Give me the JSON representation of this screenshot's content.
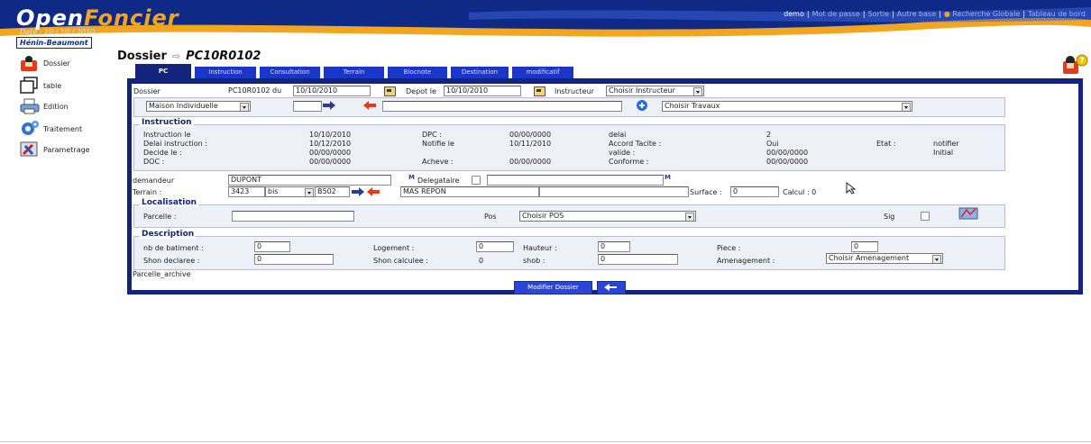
{
  "header": {
    "logo_open": "Open",
    "logo_foncier": "Foncier",
    "date": "Date : 10 / 10 / 2010",
    "city": "Hénin-Beaumont",
    "menu": {
      "user": "demo",
      "links": [
        "Mot de passe",
        "Sortie",
        "Autre base",
        "Recherche Globale",
        "Tableau de bord"
      ]
    }
  },
  "leftmenu": {
    "items": [
      "Dossier",
      "table",
      "Edition",
      "Traitement",
      "Parametrage"
    ]
  },
  "title": {
    "label": "Dossier",
    "number": "PC10R0102"
  },
  "tabs": [
    "PC",
    "Instruction",
    "Consultation",
    "Terrain",
    "Blocnote",
    "Destination",
    "modificatif"
  ],
  "dossier": {
    "label": "Dossier",
    "ref": "PC10R0102 du",
    "date": "10/10/2010",
    "depot_label": "Depot le",
    "depot_date": "10/10/2010",
    "instructeur_label": "Instructeur",
    "instructeur_value": "Choisir Instructeur",
    "nature_value": "Maison Individuelle",
    "travaux_value": "Choisir Travaux"
  },
  "instruction": {
    "legend": "Instruction",
    "rows": [
      [
        "Instruction le",
        "10/10/2010",
        "DPC :",
        "00/00/0000",
        "delai",
        "2",
        "",
        ""
      ],
      [
        "Delai instruction :",
        "10/12/2010",
        "Notifie le",
        "10/11/2010",
        "Accord Tacite :",
        "Oui",
        "Etat :",
        "notifier"
      ],
      [
        "Decide le :",
        "00/00/0000",
        "",
        "",
        "valide :",
        "00/00/0000",
        "",
        "Initial"
      ],
      [
        "DOC :",
        "00/00/0000",
        "Acheve :",
        "00/00/0000",
        "Conforme :",
        "00/00/0000",
        "",
        ""
      ]
    ]
  },
  "demandeur": {
    "label": "demandeur",
    "value": "DUPONT",
    "delegataire_label": "Delegataire",
    "m_icon": "M"
  },
  "terrain": {
    "label": "Terrain :",
    "numero": "3423",
    "bis": "bis",
    "voie_code": "B502",
    "voie_name": "MAS REPON",
    "surface_label": "Surface :",
    "surface_value": "0",
    "calcul_label": "Calcul : 0"
  },
  "localisation": {
    "legend": "Localisation",
    "parcelle_label": "Parcelle :",
    "pos_label": "Pos",
    "pos_value": "Choisir POS",
    "sig_label": "Sig"
  },
  "description": {
    "legend": "Description",
    "nb_batiment_label": "nb de batiment :",
    "nb_batiment_value": "0",
    "logement_label": "Logement :",
    "logement_value": "0",
    "hauteur_label": "Hauteur :",
    "hauteur_value": "0",
    "piece_label": "Piece :",
    "piece_value": "0",
    "shon_declaree_label": "Shon declaree :",
    "shon_declaree_value": "0",
    "shon_calculee_label": "Shon calculee :",
    "shon_calculee_value": "0",
    "shob_label": "shob :",
    "shob_value": "0",
    "amenagement_label": "Amenagement :",
    "amenagement_value": "Choisir Amenagement"
  },
  "footer": {
    "parcelle_archive": "Parcelle_archive",
    "modifier_button": "Modifier Dossier"
  },
  "colors": {
    "header_blue": "#0f2a86",
    "tab_blue": "#1a36c9",
    "accent_orange": "#f2a51f",
    "frame_navy": "#12247c"
  }
}
